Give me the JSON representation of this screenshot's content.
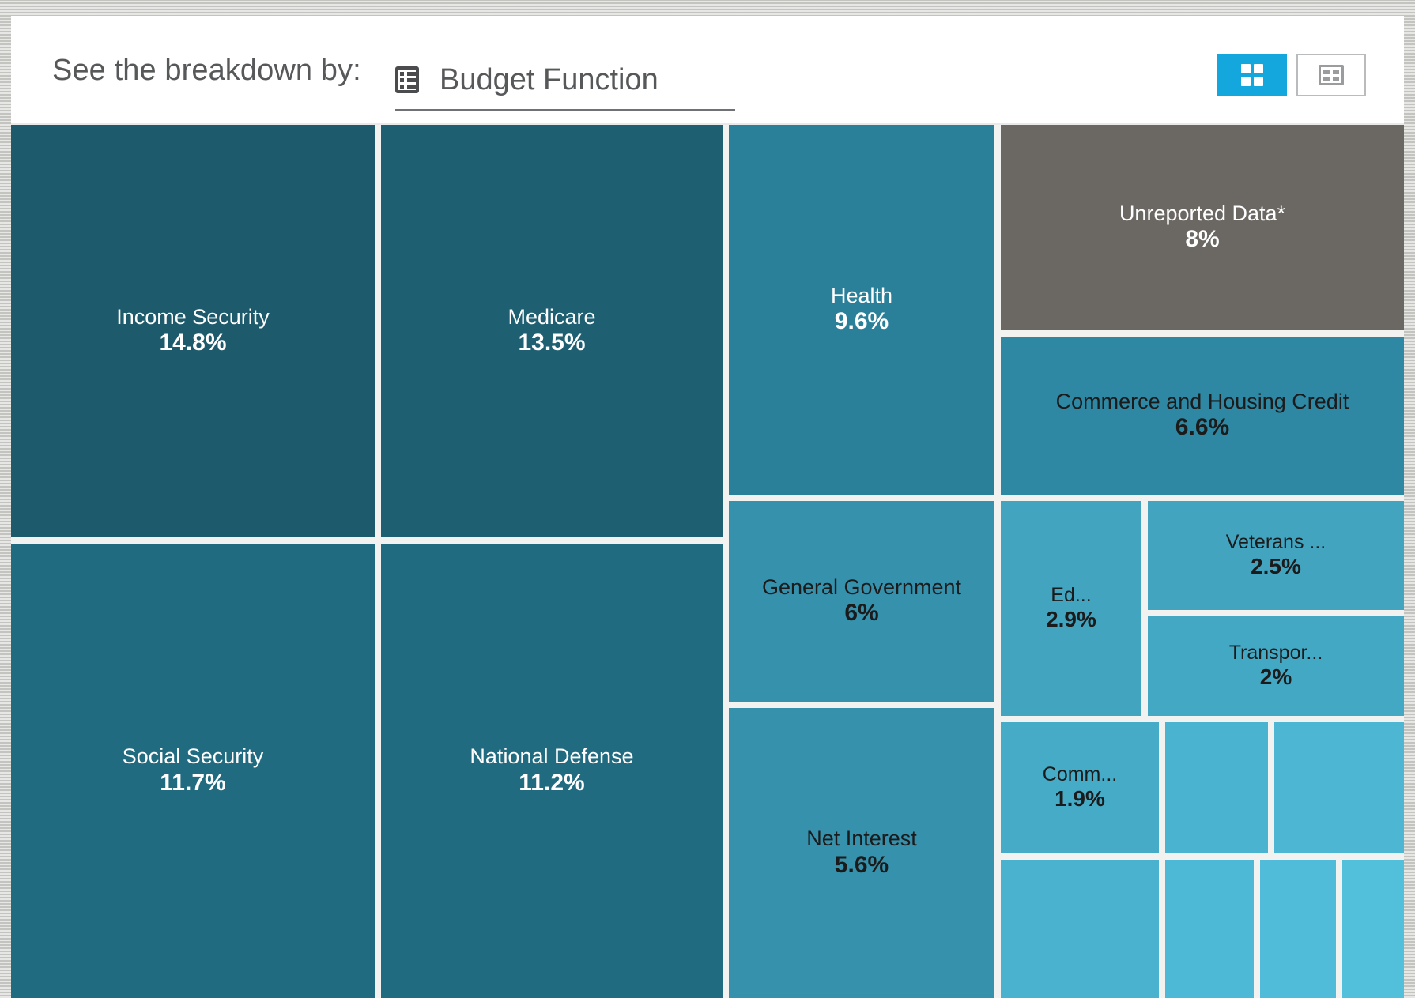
{
  "header": {
    "prompt": "See the breakdown by:",
    "dropdown_value": "Budget Function",
    "dropdown_icon": "grid-table-icon",
    "view_toggle": {
      "treemap_icon": "four-pane-treemap-icon",
      "table_icon": "table-view-icon",
      "active": "treemap"
    }
  },
  "colors": {
    "accent": "#14a7dd",
    "darkest_teal": "#1d5a6b",
    "dark_teal": "#216b80",
    "mid_teal": "#2a7f99",
    "teal": "#2e88a3",
    "light_teal": "#3d9dba",
    "lighter_teal": "#44a9c6",
    "lightest_teal": "#4cb7d4",
    "gray": "#6b6763",
    "gap": "#f2f2f0",
    "text_light": "#ffffff",
    "text_dark": "#1b1b1b"
  },
  "chart_data": {
    "type": "treemap",
    "title": "Budget Function",
    "value_unit": "percent of total",
    "tiles": [
      {
        "label": "Income Security",
        "percent_label": "14.8%",
        "value": 14.8,
        "color": "#1d5a6b",
        "text": "light"
      },
      {
        "label": "Medicare",
        "percent_label": "13.5%",
        "value": 13.5,
        "color": "#1e5f72",
        "text": "light"
      },
      {
        "label": "Social Security",
        "percent_label": "11.7%",
        "value": 11.7,
        "color": "#216b80",
        "text": "light"
      },
      {
        "label": "National Defense",
        "percent_label": "11.2%",
        "value": 11.2,
        "color": "#216b80",
        "text": "light"
      },
      {
        "label": "Health",
        "percent_label": "9.6%",
        "value": 9.6,
        "color": "#2a7f99",
        "text": "light"
      },
      {
        "label": "Unreported Data*",
        "percent_label": "8%",
        "value": 8.0,
        "color": "#6b6763",
        "text": "light"
      },
      {
        "label": "Commerce and Housing Credit",
        "percent_label": "6.6%",
        "value": 6.6,
        "color": "#2e88a3",
        "text": "dark"
      },
      {
        "label": "General Government",
        "percent_label": "6%",
        "value": 6.0,
        "color": "#3691ad",
        "text": "dark"
      },
      {
        "label": "Net Interest",
        "percent_label": "5.6%",
        "value": 5.6,
        "color": "#3691ad",
        "text": "dark"
      },
      {
        "label": "Ed...",
        "percent_label": "2.9%",
        "value": 2.9,
        "color": "#43a4c0",
        "text": "dark"
      },
      {
        "label": "Veterans ...",
        "percent_label": "2.5%",
        "value": 2.5,
        "color": "#43a4c0",
        "text": "dark"
      },
      {
        "label": "Transpor...",
        "percent_label": "2%",
        "value": 2.0,
        "color": "#43a8c4",
        "text": "dark"
      },
      {
        "label": "Comm...",
        "percent_label": "1.9%",
        "value": 1.9,
        "color": "#45abc7",
        "text": "dark"
      },
      {
        "label": "",
        "percent_label": "",
        "value": 1.2,
        "color": "#4ab3cf",
        "text": "dark"
      },
      {
        "label": "",
        "percent_label": "",
        "value": 1.1,
        "color": "#4cb6d3",
        "text": "dark"
      },
      {
        "label": "",
        "percent_label": "",
        "value": 1.0,
        "color": "#4ab2ce",
        "text": "dark"
      },
      {
        "label": "",
        "percent_label": "",
        "value": 0.8,
        "color": "#4eb9d6",
        "text": "dark"
      },
      {
        "label": "",
        "percent_label": "",
        "value": 0.7,
        "color": "#50bcd9",
        "text": "dark"
      },
      {
        "label": "",
        "percent_label": "",
        "value": 0.6,
        "color": "#52bfdb",
        "text": "dark"
      }
    ]
  }
}
